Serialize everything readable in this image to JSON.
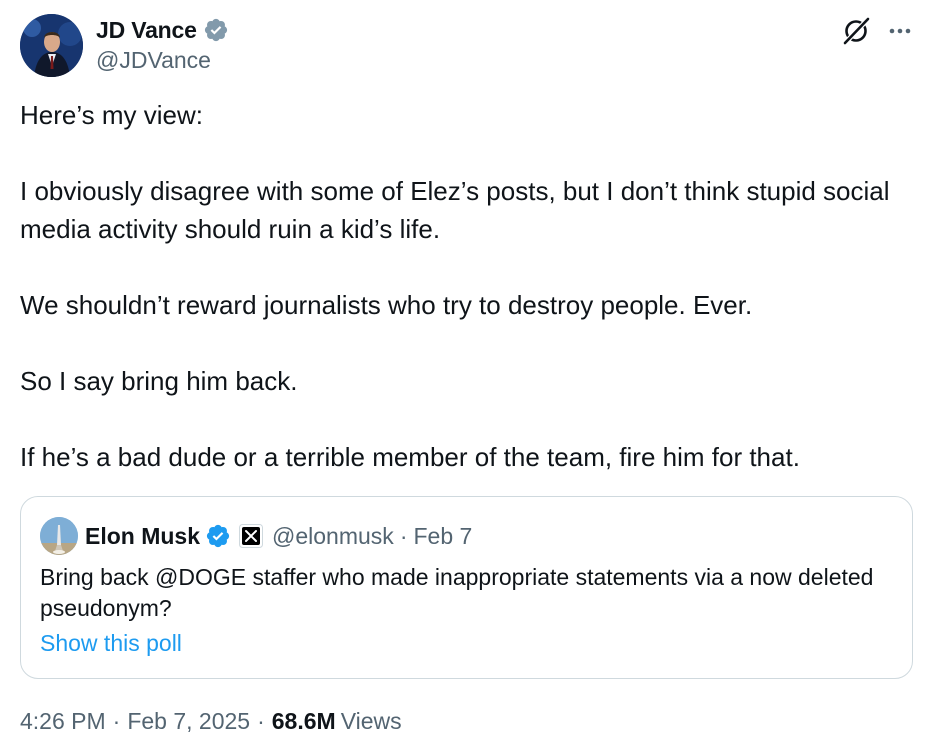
{
  "author": {
    "name": "JD Vance",
    "handle": "@JDVance",
    "verified_badge_color": "#829aab"
  },
  "header_icons": [
    "grok-icon",
    "more-options-icon"
  ],
  "tweet": {
    "paragraphs": [
      "Here’s my view:",
      "I obviously disagree with some of Elez’s posts, but I don’t think stupid social media activity should ruin a kid’s life.",
      "We shouldn’t reward journalists who try to destroy people. Ever.",
      "So I say bring him back.",
      "If he’s a bad dude or a terrible member of the team, fire him for that."
    ]
  },
  "quote": {
    "name": "Elon Musk",
    "handle": "@elonmusk",
    "separator": "·",
    "date": "Feb 7",
    "verified_badge_color": "#1d9bf0",
    "text": "Bring back @DOGE staffer who made inappropriate statements via a now deleted pseudonym?",
    "link": "Show this poll"
  },
  "meta": {
    "time": "4:26 PM",
    "separator": "·",
    "date": "Feb 7, 2025",
    "views_count": "68.6M",
    "views_label": "Views"
  },
  "colors": {
    "text": "#0f1419",
    "secondary": "#536471",
    "link": "#1d9bf0",
    "border": "#cfd9de"
  }
}
